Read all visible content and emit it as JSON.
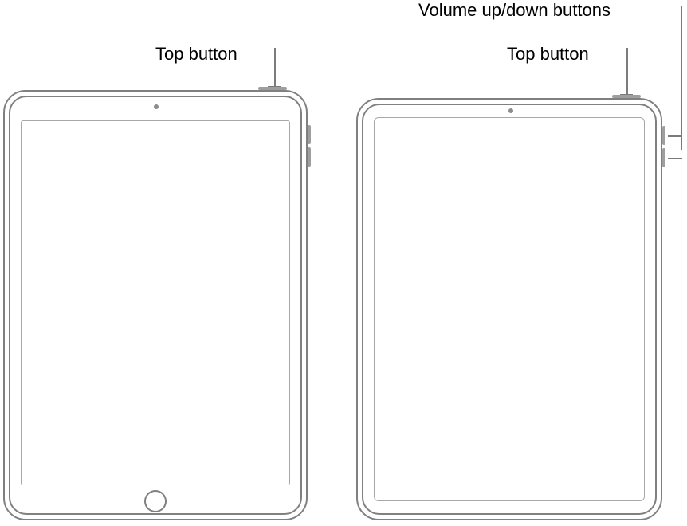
{
  "labels": {
    "left_top_button": "Top button",
    "right_top_button": "Top button",
    "volume_buttons": "Volume up/down buttons"
  },
  "devices": {
    "left": {
      "kind": "ipad-with-home-button",
      "has_home_button": true,
      "has_side_volume": true
    },
    "right": {
      "kind": "ipad-full-screen",
      "has_home_button": false,
      "has_side_volume": true
    }
  }
}
